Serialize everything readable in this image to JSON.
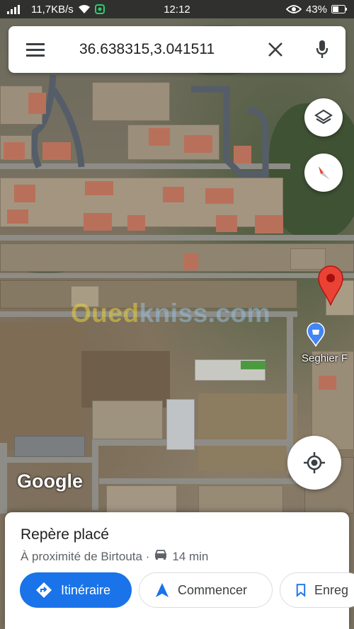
{
  "status_bar": {
    "network_speed": "11,7KB/s",
    "time": "12:12",
    "battery": "43%"
  },
  "search": {
    "query": "36.638315,3.041511"
  },
  "map": {
    "poi_label": "Seghier F",
    "watermark_part1": "Oued",
    "watermark_part2": "kniss.com",
    "google_logo": "Google"
  },
  "sheet": {
    "title": "Repère placé",
    "subtitle_prefix": "À proximité de Birtouta · ",
    "drive_time": "14 min",
    "directions_label": "Itinéraire",
    "start_label": "Commencer",
    "save_label": "Enreg"
  },
  "colors": {
    "accent": "#1a73e8",
    "pin": "#ea4335",
    "poi": "#4285f4"
  }
}
